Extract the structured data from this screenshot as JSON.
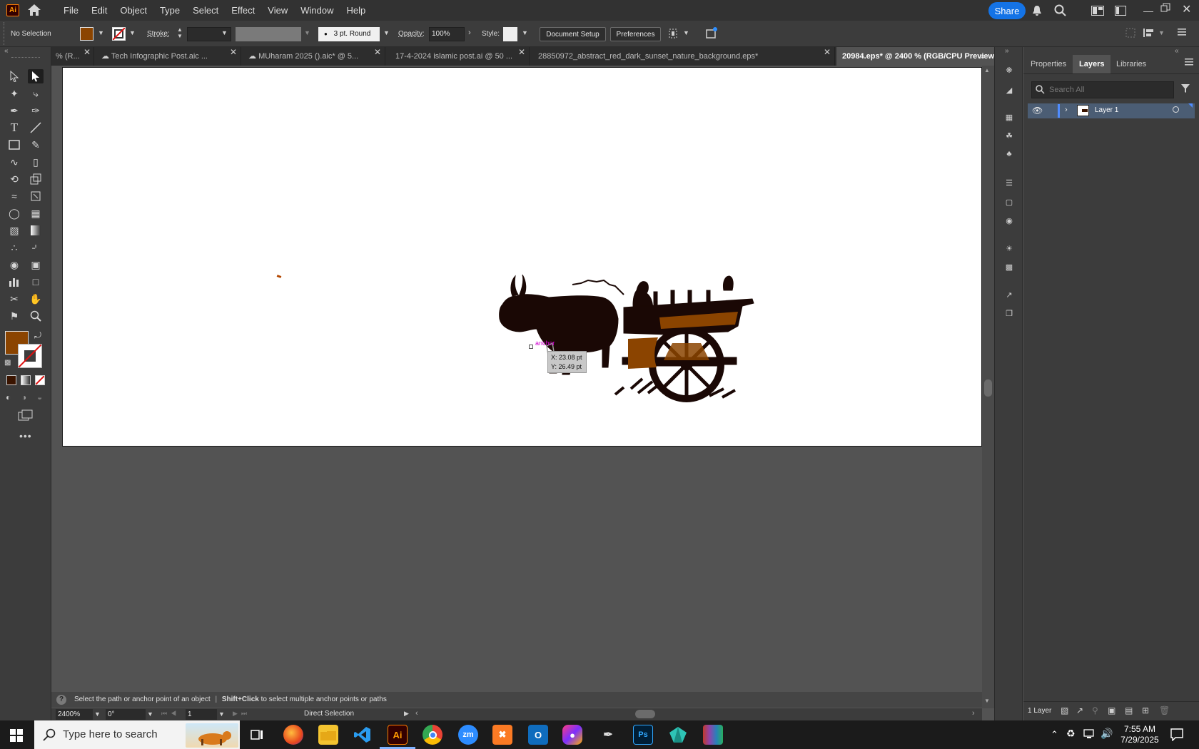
{
  "app": {
    "logo_text": "Ai"
  },
  "menu": [
    "File",
    "Edit",
    "Object",
    "Type",
    "Select",
    "Effect",
    "View",
    "Window",
    "Help"
  ],
  "header": {
    "share_label": "Share"
  },
  "control_bar": {
    "selection_label": "No Selection",
    "fill_color": "#8b4400",
    "stroke_label": "Stroke:",
    "brush_label": "3 pt. Round",
    "opacity_label": "Opacity:",
    "opacity_value": "100%",
    "style_label": "Style:",
    "document_setup_label": "Document Setup",
    "preferences_label": "Preferences"
  },
  "tabs": [
    {
      "label": "% (R...",
      "active": false
    },
    {
      "label": "Tech Infographic Post.aic ...",
      "active": false
    },
    {
      "label": "MUharam 2025 ().aic* @ 5...",
      "active": false
    },
    {
      "label": "17-4-2024 islamic post.ai @ 50 ...",
      "active": false
    },
    {
      "label": "28850972_abstract_red_dark_sunset_nature_background.eps*",
      "active": false
    },
    {
      "label": "20984.eps* @ 2400 % (RGB/CPU Preview)",
      "active": true
    }
  ],
  "canvas": {
    "anchor_hint": "anchor",
    "coord_x": "X: 23.08 pt",
    "coord_y": "Y: 26.49 pt",
    "art_dark": "#1a0805",
    "art_brown": "#8b4400"
  },
  "status": {
    "hint": "Select the path or anchor point of an object",
    "hint_bold": "Shift+Click",
    "hint_rest": "to select multiple anchor points or paths",
    "zoom": "2400%",
    "rotation": "0°",
    "artboard_number": "1",
    "tool_name": "Direct Selection"
  },
  "panel": {
    "tabs": [
      "Properties",
      "Layers",
      "Libraries"
    ],
    "active_tab": "Layers",
    "search_placeholder": "Search All",
    "layer_name": "Layer 1",
    "layer_count": "1 Layer"
  },
  "taskbar": {
    "search_placeholder": "Type here to search",
    "time": "7:55 AM",
    "date": "7/29/2025"
  }
}
